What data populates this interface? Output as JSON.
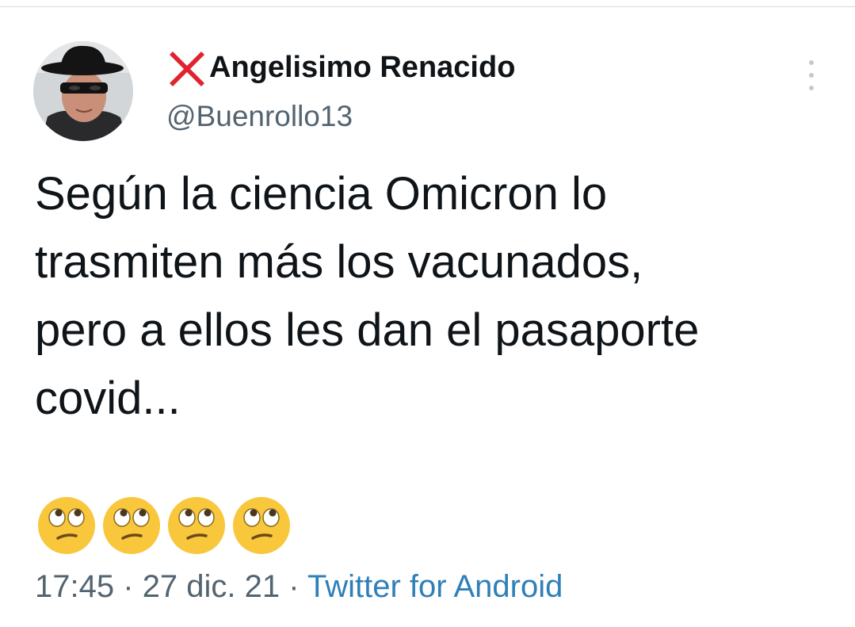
{
  "tweet": {
    "display_name": "Angelisimo Renacido",
    "handle": "@Buenrollo13",
    "text_lines": [
      "Según la ciencia Omicron lo",
      "trasmiten más los vacunados,",
      "pero a ellos les dan el pasaporte",
      "covid..."
    ],
    "emojis": [
      "face-with-rolling-eyes",
      "face-with-rolling-eyes",
      "face-with-rolling-eyes",
      "face-with-rolling-eyes"
    ],
    "time": "17:45",
    "separator": "·",
    "date": "27 dic. 21",
    "source": "Twitter for Android"
  },
  "icons": {
    "name_prefix": "cross-mark-icon",
    "more": "more-vertical-icon"
  },
  "colors": {
    "cross_mark": "#e0242d",
    "text": "#0f1419",
    "secondary": "#536471",
    "source_link": "#2f7fb8"
  }
}
